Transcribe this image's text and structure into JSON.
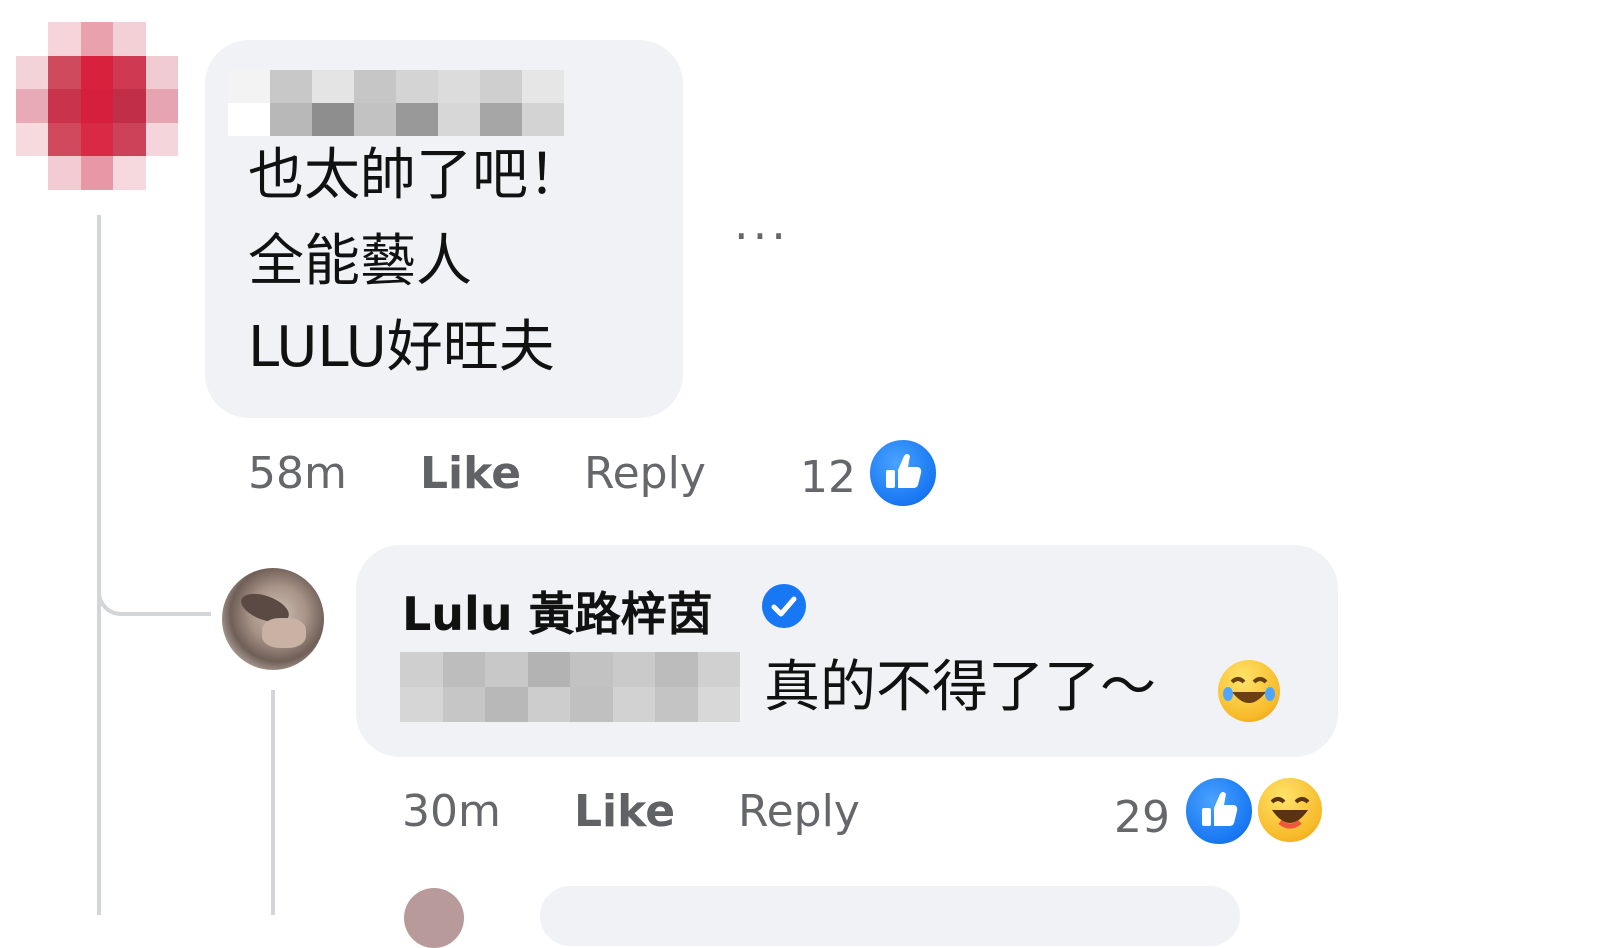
{
  "comment": {
    "text_lines": [
      "也太帥了吧！",
      "全能藝人",
      "LULU好旺夫"
    ],
    "more_label": "...",
    "time": "58m",
    "like_label": "Like",
    "reply_label": "Reply",
    "reaction_count": "12"
  },
  "reply": {
    "author": "Lulu 黃路梓茵",
    "text": "真的不得了了～",
    "time": "30m",
    "like_label": "Like",
    "reply_label": "Reply",
    "reaction_count": "29"
  },
  "icons": {
    "like": "like-reaction-icon",
    "haha": "haha-reaction-icon",
    "verified": "verified-badge-icon",
    "more": "more-options-icon"
  },
  "colors": {
    "bubble": "#f0f2f5",
    "like_blue": "#1877f2",
    "meta_gray": "#65676b",
    "haha_yellow": "#f7b928"
  }
}
